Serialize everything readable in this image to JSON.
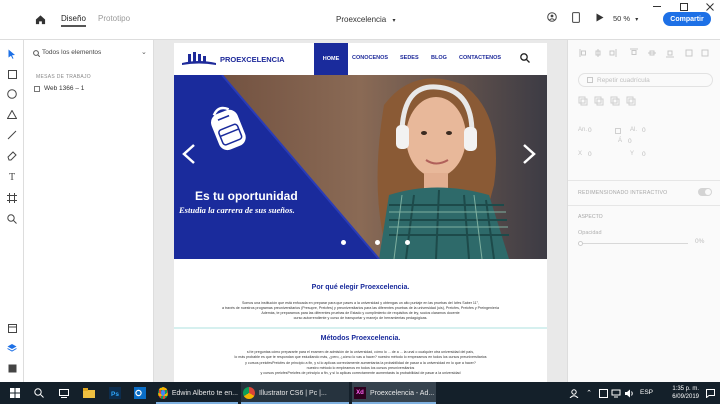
{
  "app": {
    "tabs": [
      "Diseño",
      "Prototipo"
    ],
    "document_title": "Proexcelencia",
    "zoom": "50 %",
    "share_label": "Compartir"
  },
  "layers": {
    "search_placeholder": "Todos los elementos",
    "section_label": "MESAS DE TRABAJO",
    "artboard_name": "Web 1366 – 1"
  },
  "site": {
    "brand": "PROEXCELENCIA",
    "nav": [
      "HOME",
      "CONOCENOS",
      "SEDES",
      "BLOG",
      "CONTACTENOS"
    ],
    "hero_title": "Es tu oportunidad",
    "hero_subtitle": "Estudia la carrera de sus sueños.",
    "section1_title": "Por qué elegir Proexcelencia.",
    "section1_lines": [
      "Somos una institución que está enfocada en preparar para que pases a la universidad y obtengas un alto puntaje en las pruebas del Icfes Saber 11°,",
      "a través de nuestros programas preuniversitarios (Presupre, Preicfes) y preuniversitarios para las diferentes pruebas de la universidad (uis), Preicfes, Preicfes y Preingeniería",
      "Además, te preparamos para las diferentes pruebas de Estado y cumplimiento de requisitos de ley, socios claramos docente",
      "curso autorrendiente y curso de transportar y manejo de herramientas pedagógicas."
    ],
    "section2_title": "Métodos Proexcelencia.",
    "section2_lines": [
      "si te preguntas cómo prepararte para el examen de admisión de la universidad, cómo lo ... de a ... la unal o cualquier otra universidad del país,",
      "lo más probable es que te respondan que estudiando más, ¿pero, ¿cómo lo vas a hacer? nuestro método lo empezamos en todos los cursos preuniversitarios",
      "y cursos preicfesPreicfes de principio a fin, y si lo aplicas correctamente aumentarás la probabilidad de pasar a la universidad en lo que a hacer?",
      "nuestro método lo empleamos en todos los cursos preuniversitarios",
      "y cursos preicfesPreicfes de principio a fin, y si lo aplicas correctamente aumentarás la probabilidad de pasar a la universidad"
    ]
  },
  "inspector": {
    "repeat_grid": "Repetir cuadrícula",
    "fields": [
      {
        "label": "An.",
        "value": "0"
      },
      {
        "label": "Al.",
        "value": "0"
      },
      {
        "label": "X",
        "value": "0"
      },
      {
        "label": "Y",
        "value": "0"
      },
      {
        "label": "Á",
        "value": "0"
      }
    ],
    "responsive_label": "REDIMENSIONADO INTERACTIVO",
    "appearance_label": "ASPECTO",
    "opacity_label": "Opacidad",
    "opacity_value": "0%"
  },
  "taskbar": {
    "apps": [
      {
        "label": "Edwin Alberto te en..."
      },
      {
        "label": "Illustrator CS6 | Pc |..."
      },
      {
        "label": "Proexcelencia - Ad..."
      }
    ],
    "lang": "ESP",
    "time": "1:35 p. m.",
    "date": "6/09/2019"
  },
  "colors": {
    "accent": "#1d70e6",
    "brand_blue": "#1e2a9a",
    "hero_blue": "#1a2b9c",
    "taskbar": "#14202a"
  }
}
